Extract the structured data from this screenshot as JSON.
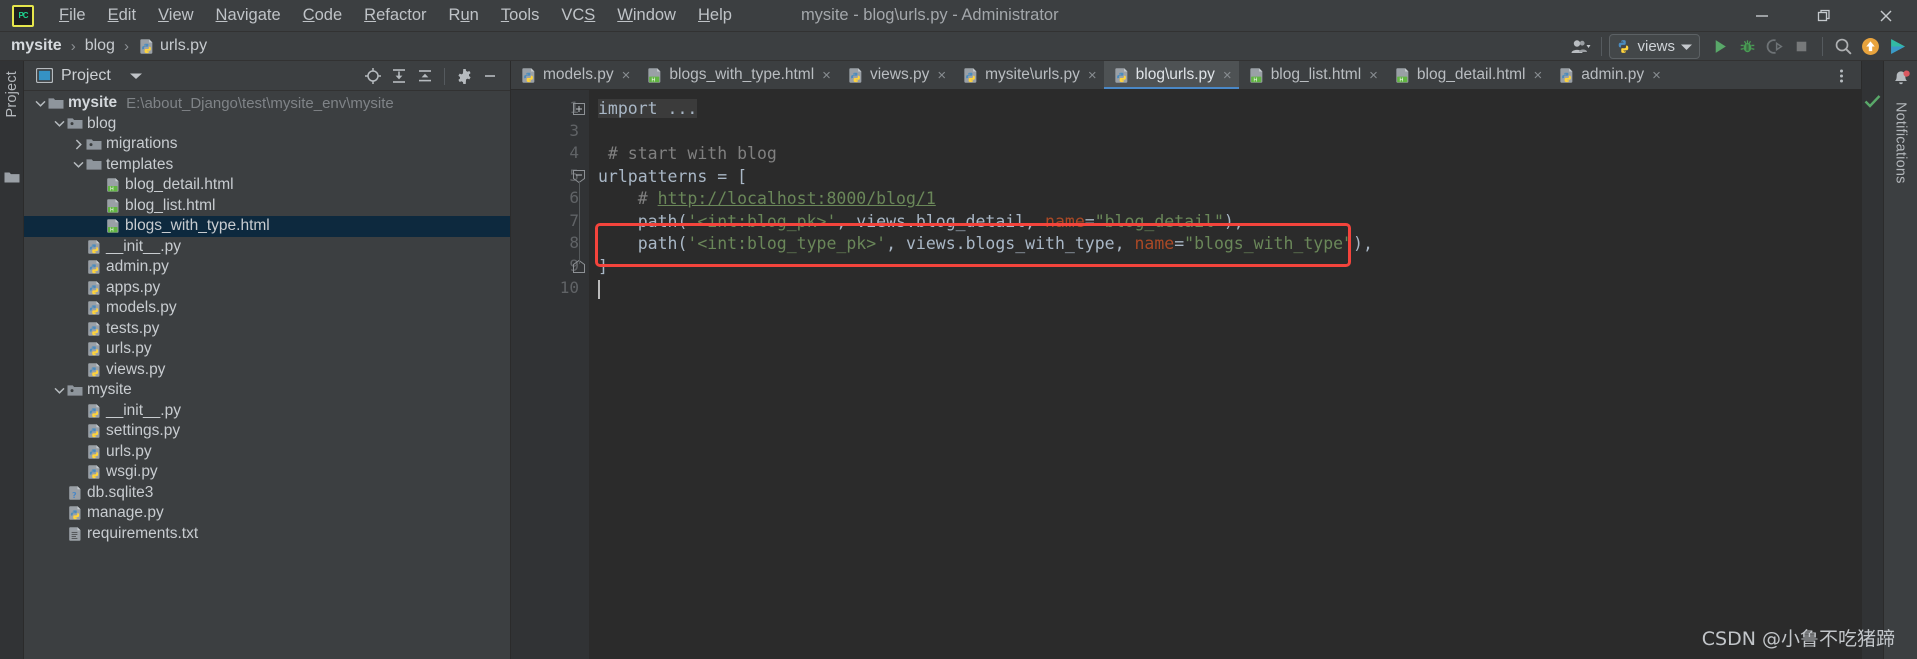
{
  "window": {
    "title": "mysite - blog\\urls.py - Administrator",
    "app_icon": "pycharm-logo-icon",
    "controls": [
      {
        "name": "minimize-button",
        "icon": "minimize-icon"
      },
      {
        "name": "restore-button",
        "icon": "restore-icon"
      },
      {
        "name": "close-button",
        "icon": "close-icon"
      }
    ]
  },
  "menubar": {
    "items": [
      {
        "label": "File",
        "mnemonic": "F"
      },
      {
        "label": "Edit",
        "mnemonic": "E"
      },
      {
        "label": "View",
        "mnemonic": "V"
      },
      {
        "label": "Navigate",
        "mnemonic": "N"
      },
      {
        "label": "Code",
        "mnemonic": "C"
      },
      {
        "label": "Refactor",
        "mnemonic": "R"
      },
      {
        "label": "Run",
        "mnemonic": "u"
      },
      {
        "label": "Tools",
        "mnemonic": "T"
      },
      {
        "label": "VCS",
        "mnemonic": "S"
      },
      {
        "label": "Window",
        "mnemonic": "W"
      },
      {
        "label": "Help",
        "mnemonic": "H"
      }
    ]
  },
  "breadcrumb": {
    "segments": [
      {
        "label": "mysite",
        "icon": null,
        "bold": true
      },
      {
        "label": "blog",
        "icon": null,
        "bold": false
      },
      {
        "label": "urls.py",
        "icon": "python-file-icon",
        "bold": false
      }
    ],
    "separator": "›"
  },
  "toolbar": {
    "user_button": {
      "name": "user-account-button",
      "icon": "user-icon"
    },
    "run_config": {
      "name": "run-configuration-selector",
      "label": "views",
      "icon": "python-file-icon"
    },
    "buttons": [
      {
        "name": "run-button",
        "icon": "run-triangle-icon",
        "color": "#59a869"
      },
      {
        "name": "debug-button",
        "icon": "debug-bug-icon",
        "color": "#499c54"
      },
      {
        "name": "run-with-coverage-button",
        "icon": "coverage-icon",
        "color": "#6e7376"
      },
      {
        "name": "stop-button",
        "icon": "stop-square-icon",
        "color": "#77797a"
      },
      {
        "name": "search-everywhere-button",
        "icon": "search-icon",
        "color": "#afb1b3"
      },
      {
        "name": "update-project-button",
        "icon": "update-arrow-icon",
        "color": "#e8a33d"
      },
      {
        "name": "ide-assistant-button",
        "icon": "colored-play-icon",
        "color": "#3bb6d6"
      }
    ]
  },
  "left_tool_strip": {
    "label": "Project",
    "folder_icon": "folder-icon"
  },
  "project_panel": {
    "header": {
      "title": "Project",
      "icon": "project-view-icon",
      "caret": "chevron-down-icon",
      "tools": [
        {
          "name": "select-opened-file-button",
          "icon": "target-locate-icon"
        },
        {
          "name": "expand-all-button",
          "icon": "expand-all-icon"
        },
        {
          "name": "collapse-all-button",
          "icon": "collapse-all-icon"
        },
        {
          "name": "settings-button",
          "icon": "gear-icon"
        },
        {
          "name": "hide-panel-button",
          "icon": "minimize-icon"
        }
      ]
    },
    "tree": [
      {
        "label": "mysite",
        "path": "E:\\about_Django\\test\\mysite_env\\mysite",
        "icon": "module-folder-icon",
        "arrow": "chevron-down-icon",
        "depth": 0,
        "bold": true,
        "selected": false
      },
      {
        "label": "blog",
        "path": "",
        "icon": "source-folder-icon",
        "arrow": "chevron-down-icon",
        "depth": 1,
        "bold": false,
        "selected": false
      },
      {
        "label": "migrations",
        "path": "",
        "icon": "source-folder-icon",
        "arrow": "chevron-right-icon",
        "depth": 2,
        "bold": false,
        "selected": false
      },
      {
        "label": "templates",
        "path": "",
        "icon": "folder-icon",
        "arrow": "chevron-down-icon",
        "depth": 2,
        "bold": false,
        "selected": false
      },
      {
        "label": "blog_detail.html",
        "path": "",
        "icon": "html-file-icon",
        "arrow": "",
        "depth": 3,
        "bold": false,
        "selected": false
      },
      {
        "label": "blog_list.html",
        "path": "",
        "icon": "html-file-icon",
        "arrow": "",
        "depth": 3,
        "bold": false,
        "selected": false
      },
      {
        "label": "blogs_with_type.html",
        "path": "",
        "icon": "html-file-icon",
        "arrow": "",
        "depth": 3,
        "bold": false,
        "selected": true
      },
      {
        "label": "__init__.py",
        "path": "",
        "icon": "python-file-icon",
        "arrow": "",
        "depth": 2,
        "bold": false,
        "selected": false
      },
      {
        "label": "admin.py",
        "path": "",
        "icon": "python-file-icon",
        "arrow": "",
        "depth": 2,
        "bold": false,
        "selected": false
      },
      {
        "label": "apps.py",
        "path": "",
        "icon": "python-file-icon",
        "arrow": "",
        "depth": 2,
        "bold": false,
        "selected": false
      },
      {
        "label": "models.py",
        "path": "",
        "icon": "python-file-icon",
        "arrow": "",
        "depth": 2,
        "bold": false,
        "selected": false
      },
      {
        "label": "tests.py",
        "path": "",
        "icon": "python-file-icon",
        "arrow": "",
        "depth": 2,
        "bold": false,
        "selected": false
      },
      {
        "label": "urls.py",
        "path": "",
        "icon": "python-file-icon",
        "arrow": "",
        "depth": 2,
        "bold": false,
        "selected": false
      },
      {
        "label": "views.py",
        "path": "",
        "icon": "python-file-icon",
        "arrow": "",
        "depth": 2,
        "bold": false,
        "selected": false
      },
      {
        "label": "mysite",
        "path": "",
        "icon": "source-folder-icon",
        "arrow": "chevron-down-icon",
        "depth": 1,
        "bold": false,
        "selected": false
      },
      {
        "label": "__init__.py",
        "path": "",
        "icon": "python-file-icon",
        "arrow": "",
        "depth": 2,
        "bold": false,
        "selected": false
      },
      {
        "label": "settings.py",
        "path": "",
        "icon": "python-file-icon",
        "arrow": "",
        "depth": 2,
        "bold": false,
        "selected": false
      },
      {
        "label": "urls.py",
        "path": "",
        "icon": "python-file-icon",
        "arrow": "",
        "depth": 2,
        "bold": false,
        "selected": false
      },
      {
        "label": "wsgi.py",
        "path": "",
        "icon": "python-file-icon",
        "arrow": "",
        "depth": 2,
        "bold": false,
        "selected": false
      },
      {
        "label": "db.sqlite3",
        "path": "",
        "icon": "unknown-file-icon",
        "arrow": "",
        "depth": 1,
        "bold": false,
        "selected": false
      },
      {
        "label": "manage.py",
        "path": "",
        "icon": "python-file-icon",
        "arrow": "",
        "depth": 1,
        "bold": false,
        "selected": false
      },
      {
        "label": "requirements.txt",
        "path": "",
        "icon": "text-file-icon",
        "arrow": "",
        "depth": 1,
        "bold": false,
        "selected": false
      }
    ]
  },
  "editor_tabs": {
    "items": [
      {
        "label": "models.py",
        "icon": "python-file-icon",
        "active": false,
        "close": "×"
      },
      {
        "label": "blogs_with_type.html",
        "icon": "html-file-icon",
        "active": false,
        "close": "×"
      },
      {
        "label": "views.py",
        "icon": "python-file-icon",
        "active": false,
        "close": "×"
      },
      {
        "label": "mysite\\urls.py",
        "icon": "python-file-icon",
        "active": false,
        "close": "×"
      },
      {
        "label": "blog\\urls.py",
        "icon": "python-file-icon",
        "active": true,
        "close": "×"
      },
      {
        "label": "blog_list.html",
        "icon": "html-file-icon",
        "active": false,
        "close": "×"
      },
      {
        "label": "blog_detail.html",
        "icon": "html-file-icon",
        "active": false,
        "close": "×"
      },
      {
        "label": "admin.py",
        "icon": "python-file-icon",
        "active": false,
        "close": "×"
      }
    ],
    "overflow_icon": "more-vertical-icon"
  },
  "editor": {
    "filename": "blog\\urls.py",
    "line_numbers": [
      "1",
      "3",
      "4",
      "5",
      "6",
      "7",
      "8",
      "9",
      "10"
    ],
    "lines": [
      {
        "num": "1",
        "fold": "plus",
        "tokens": [
          {
            "t": "import ...",
            "c": "plain",
            "folded": true
          }
        ]
      },
      {
        "num": "3",
        "fold": "",
        "tokens": []
      },
      {
        "num": "4",
        "fold": "",
        "tokens": [
          {
            "t": " # start with blog",
            "c": "cmt"
          }
        ]
      },
      {
        "num": "5",
        "fold": "minus",
        "tokens": [
          {
            "t": "urlpatterns",
            "c": "plain"
          },
          {
            "t": " = [",
            "c": "plain"
          }
        ]
      },
      {
        "num": "6",
        "fold": "",
        "tokens": [
          {
            "t": "    # ",
            "c": "cmt"
          },
          {
            "t": "http://localhost:8000/blog/1",
            "c": "lnk"
          }
        ]
      },
      {
        "num": "7",
        "fold": "",
        "tokens": [
          {
            "t": "    path(",
            "c": "plain"
          },
          {
            "t": "'<int:blog_pk>'",
            "c": "str"
          },
          {
            "t": ", views.blog_detail, ",
            "c": "plain"
          },
          {
            "t": "name",
            "c": "kwarg"
          },
          {
            "t": "=",
            "c": "plain"
          },
          {
            "t": "\"blog_detail\"",
            "c": "str"
          },
          {
            "t": "),",
            "c": "plain"
          }
        ]
      },
      {
        "num": "8",
        "fold": "",
        "tokens": [
          {
            "t": "    path(",
            "c": "plain"
          },
          {
            "t": "'<int:blog_type_pk>'",
            "c": "str"
          },
          {
            "t": ", views.blogs_with_type, ",
            "c": "plain"
          },
          {
            "t": "name",
            "c": "kwarg"
          },
          {
            "t": "=",
            "c": "plain"
          },
          {
            "t": "\"blogs_with_type\"",
            "c": "str"
          },
          {
            "t": "),",
            "c": "plain"
          }
        ]
      },
      {
        "num": "9",
        "fold": "end",
        "tokens": [
          {
            "t": "]",
            "c": "plain"
          }
        ]
      },
      {
        "num": "10",
        "fold": "",
        "tokens": []
      }
    ],
    "annotation": {
      "name": "red-highlight-box",
      "color": "#f4443c",
      "targets_line": "8"
    },
    "caret_line": "10"
  },
  "marker_bar": {
    "more_icon": "more-vertical-icon",
    "status_icon": "green-check-icon",
    "status_color": "#59a869"
  },
  "notifications": {
    "label": "Notifications",
    "icon": "bell-icon",
    "badge_color": "#db5860"
  },
  "watermark": {
    "text": "CSDN @小鲁不吃猪蹄"
  },
  "colors": {
    "chrome": "#3c3f41",
    "panel": "#313335",
    "editor_bg": "#2b2b2b",
    "selection": "#0d293e",
    "accent": "#4a88c7",
    "annotation": "#f4443c"
  }
}
